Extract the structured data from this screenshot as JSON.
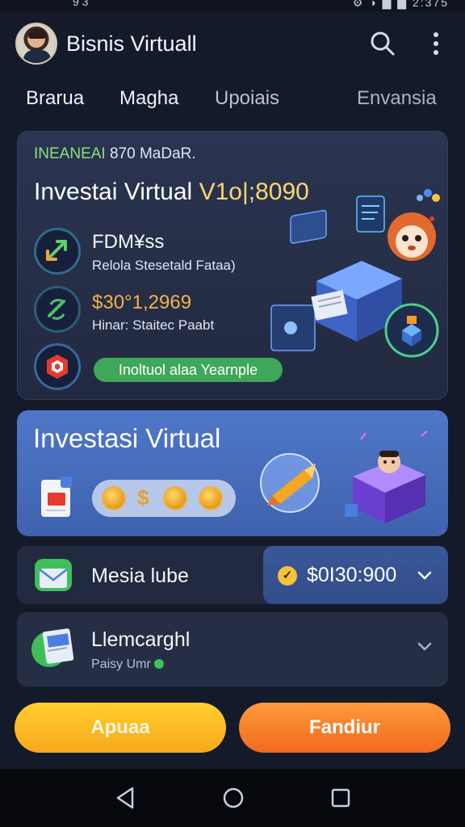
{
  "status": {
    "left": "9 3",
    "right": "⚙ ◑ ▇ ▇ 2:375"
  },
  "header": {
    "title": "Bisnis Virtuall"
  },
  "tabs": [
    "Brarua",
    "Magha",
    "Upoiais",
    "Envansia"
  ],
  "card1": {
    "tag_highlight": "INEANEAI",
    "tag_rest": " 870 MaDaR.",
    "title": "Investai Virtual ",
    "title_amount": "V1o|;8090",
    "row1_label": "FDM¥ss",
    "row1_sub": "Relola Stesetald Fataa)",
    "row2_label": "$30°1,2969",
    "row2_sub": "Hinar: Staitec Paabt",
    "pill": "Inoltuol alaa Yearnple"
  },
  "card2": {
    "title": "Investasi Virtual",
    "coin_symbol": "$"
  },
  "row3": {
    "label": "Mesia lube",
    "value": "$0I30:900",
    "check": "✓"
  },
  "row4": {
    "label": "Llemcarghl",
    "sub": "Paisy Umr"
  },
  "buttons": {
    "primary": "Apuaa",
    "secondary": "Fandiur"
  },
  "colors": {
    "accent_yellow": "#f7a81c",
    "accent_orange": "#f0691d",
    "card_blue": "#4f77c9",
    "success_green": "#3fa65a"
  }
}
